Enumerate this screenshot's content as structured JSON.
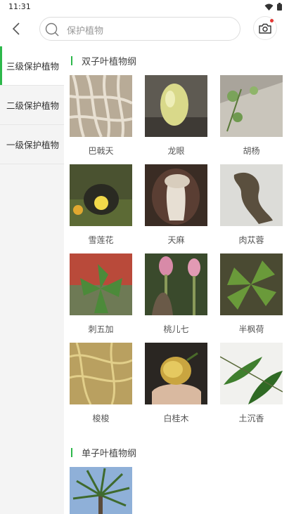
{
  "status_bar": {
    "time": "11:31"
  },
  "header": {
    "search_placeholder": "保护植物"
  },
  "sidebar": {
    "items": [
      {
        "label": "三级保护植物",
        "active": true
      },
      {
        "label": "二级保护植物",
        "active": false
      },
      {
        "label": "一级保护植物",
        "active": false
      }
    ]
  },
  "sections": [
    {
      "title": "双子叶植物纲",
      "plants": [
        {
          "name": "巴戟天"
        },
        {
          "name": "龙眼"
        },
        {
          "name": "胡杨"
        },
        {
          "name": "雪莲花"
        },
        {
          "name": "天麻"
        },
        {
          "name": "肉苁蓉"
        },
        {
          "name": "刺五加"
        },
        {
          "name": "桃儿七"
        },
        {
          "name": "半枫荷"
        },
        {
          "name": "梭梭"
        },
        {
          "name": "白桂木"
        },
        {
          "name": "土沉香"
        }
      ]
    },
    {
      "title": "单子叶植物纲",
      "plants": [
        {
          "name": ""
        }
      ]
    }
  ],
  "colors": {
    "accent": "#2db84b",
    "sidebar_bg": "#f4f4f4"
  }
}
